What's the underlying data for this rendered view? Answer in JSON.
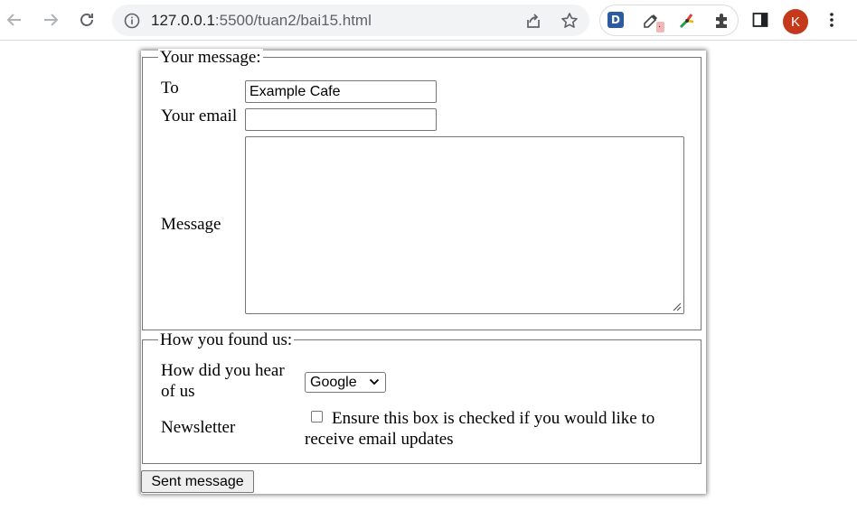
{
  "browser": {
    "url_host": "127.0.0.1",
    "url_rest": ":5500/tuan2/bai15.html",
    "extension_d_letter": "D",
    "profile_initial": "K"
  },
  "form": {
    "message_fieldset": {
      "legend": "Your message:",
      "to_label": "To",
      "to_value": "Example Cafe",
      "email_label": "Your email",
      "email_value": "",
      "message_label": "Message",
      "message_value": ""
    },
    "found_fieldset": {
      "legend": "How you found us:",
      "hear_label_line1": "How did you hear",
      "hear_label_line2": "of us",
      "hear_selected": "Google",
      "newsletter_label": "Newsletter",
      "newsletter_text_line1": "Ensure this box is checked if you would like to",
      "newsletter_text_line2": "receive email updates",
      "newsletter_checked": false
    },
    "submit_label": "Sent message"
  },
  "colors": {
    "avatar": "#c5391b",
    "extension_d": "#2d5aa0",
    "border": "#767676"
  }
}
